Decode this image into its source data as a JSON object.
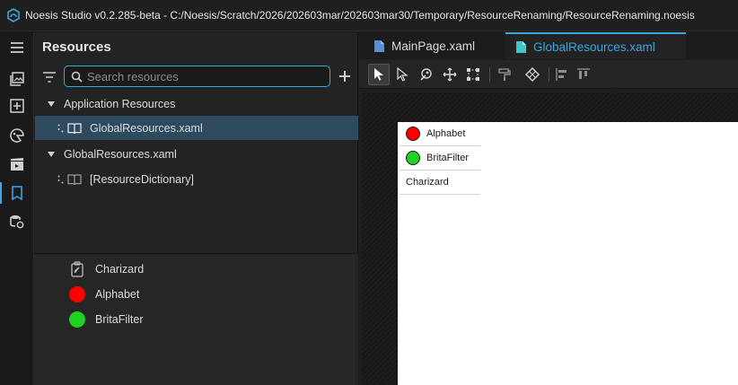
{
  "window": {
    "title": "Noesis Studio v0.2.285-beta - C:/Noesis/Scratch/2026/202603mar/202603mar30/Temporary/ResourceRenaming/ResourceRenaming.noesis"
  },
  "panel": {
    "title": "Resources",
    "search_placeholder": "Search resources",
    "tree": [
      {
        "label": "Application Resources",
        "kind": "group"
      },
      {
        "label": "GlobalResources.xaml",
        "kind": "child",
        "selected": true
      },
      {
        "label": "GlobalResources.xaml",
        "kind": "group"
      },
      {
        "label": "[ResourceDictionary]",
        "kind": "child",
        "selected": false
      }
    ],
    "resources": [
      {
        "label": "Charizard",
        "icon": "brush-icon"
      },
      {
        "label": "Alphabet",
        "icon": "color-swatch",
        "color": "#ff0000"
      },
      {
        "label": "BritaFilter",
        "icon": "color-swatch",
        "color": "#1fd21f"
      }
    ]
  },
  "editor": {
    "tabs": [
      {
        "label": "MainPage.xaml",
        "active": false
      },
      {
        "label": "GlobalResources.xaml",
        "active": true
      }
    ]
  },
  "artboard": {
    "items": [
      {
        "label": "Alphabet",
        "color": "#ff0000"
      },
      {
        "label": "BritaFilter",
        "color": "#1fd21f"
      },
      {
        "label": "Charizard",
        "color": null
      }
    ]
  },
  "colors": {
    "accent": "#3ba7e3",
    "selection": "#2e4a5e"
  }
}
